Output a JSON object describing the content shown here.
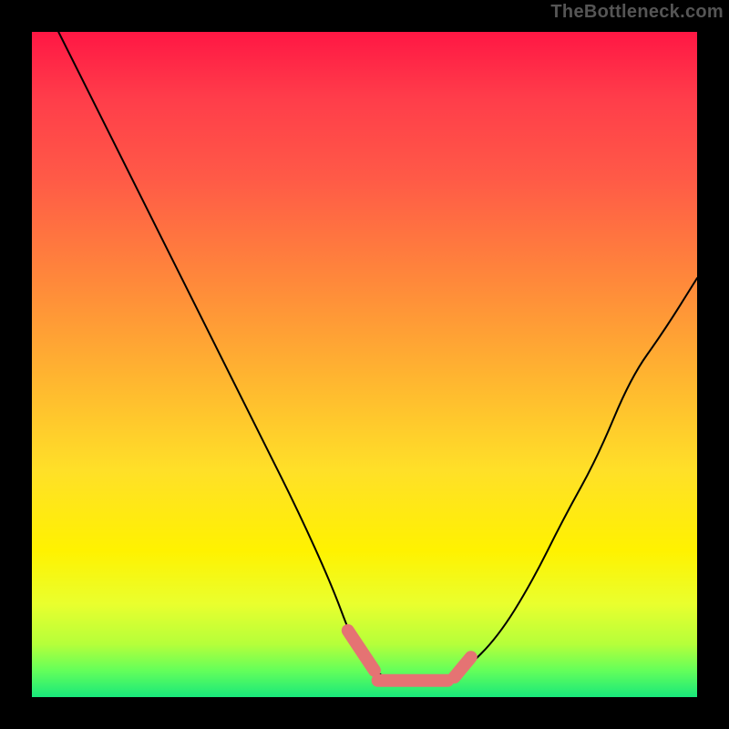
{
  "watermark": "TheBottleneck.com",
  "colors": {
    "gradient_top": "#ff1744",
    "gradient_bottom": "#18e87b",
    "curve": "#000000",
    "marker": "#e57373",
    "page_bg": "#000000"
  },
  "chart_data": {
    "type": "line",
    "title": "",
    "xlabel": "",
    "ylabel": "",
    "xlim": [
      0,
      100
    ],
    "ylim": [
      0,
      100
    ],
    "grid": false,
    "legend": false,
    "series": [
      {
        "name": "bottleneck-curve",
        "x": [
          4,
          10,
          15,
          20,
          25,
          30,
          35,
          40,
          45,
          48,
          50,
          53,
          55,
          58,
          62,
          65,
          70,
          75,
          80,
          85,
          90,
          95,
          100
        ],
        "y": [
          100,
          88,
          78,
          68,
          58,
          48,
          38,
          28,
          17,
          9,
          5,
          3,
          2,
          2,
          2,
          4,
          9,
          17,
          27,
          36,
          48,
          55,
          63
        ]
      }
    ],
    "markers": [
      {
        "name": "valley-left-edge",
        "shape": "segment",
        "x": [
          47.5,
          51.5
        ],
        "y": [
          10,
          4
        ]
      },
      {
        "name": "valley-floor",
        "shape": "segment",
        "x": [
          52,
          62.5
        ],
        "y": [
          2.5,
          2.5
        ]
      },
      {
        "name": "valley-right-edge",
        "shape": "segment",
        "x": [
          63.5,
          66
        ],
        "y": [
          3,
          6
        ]
      }
    ]
  }
}
